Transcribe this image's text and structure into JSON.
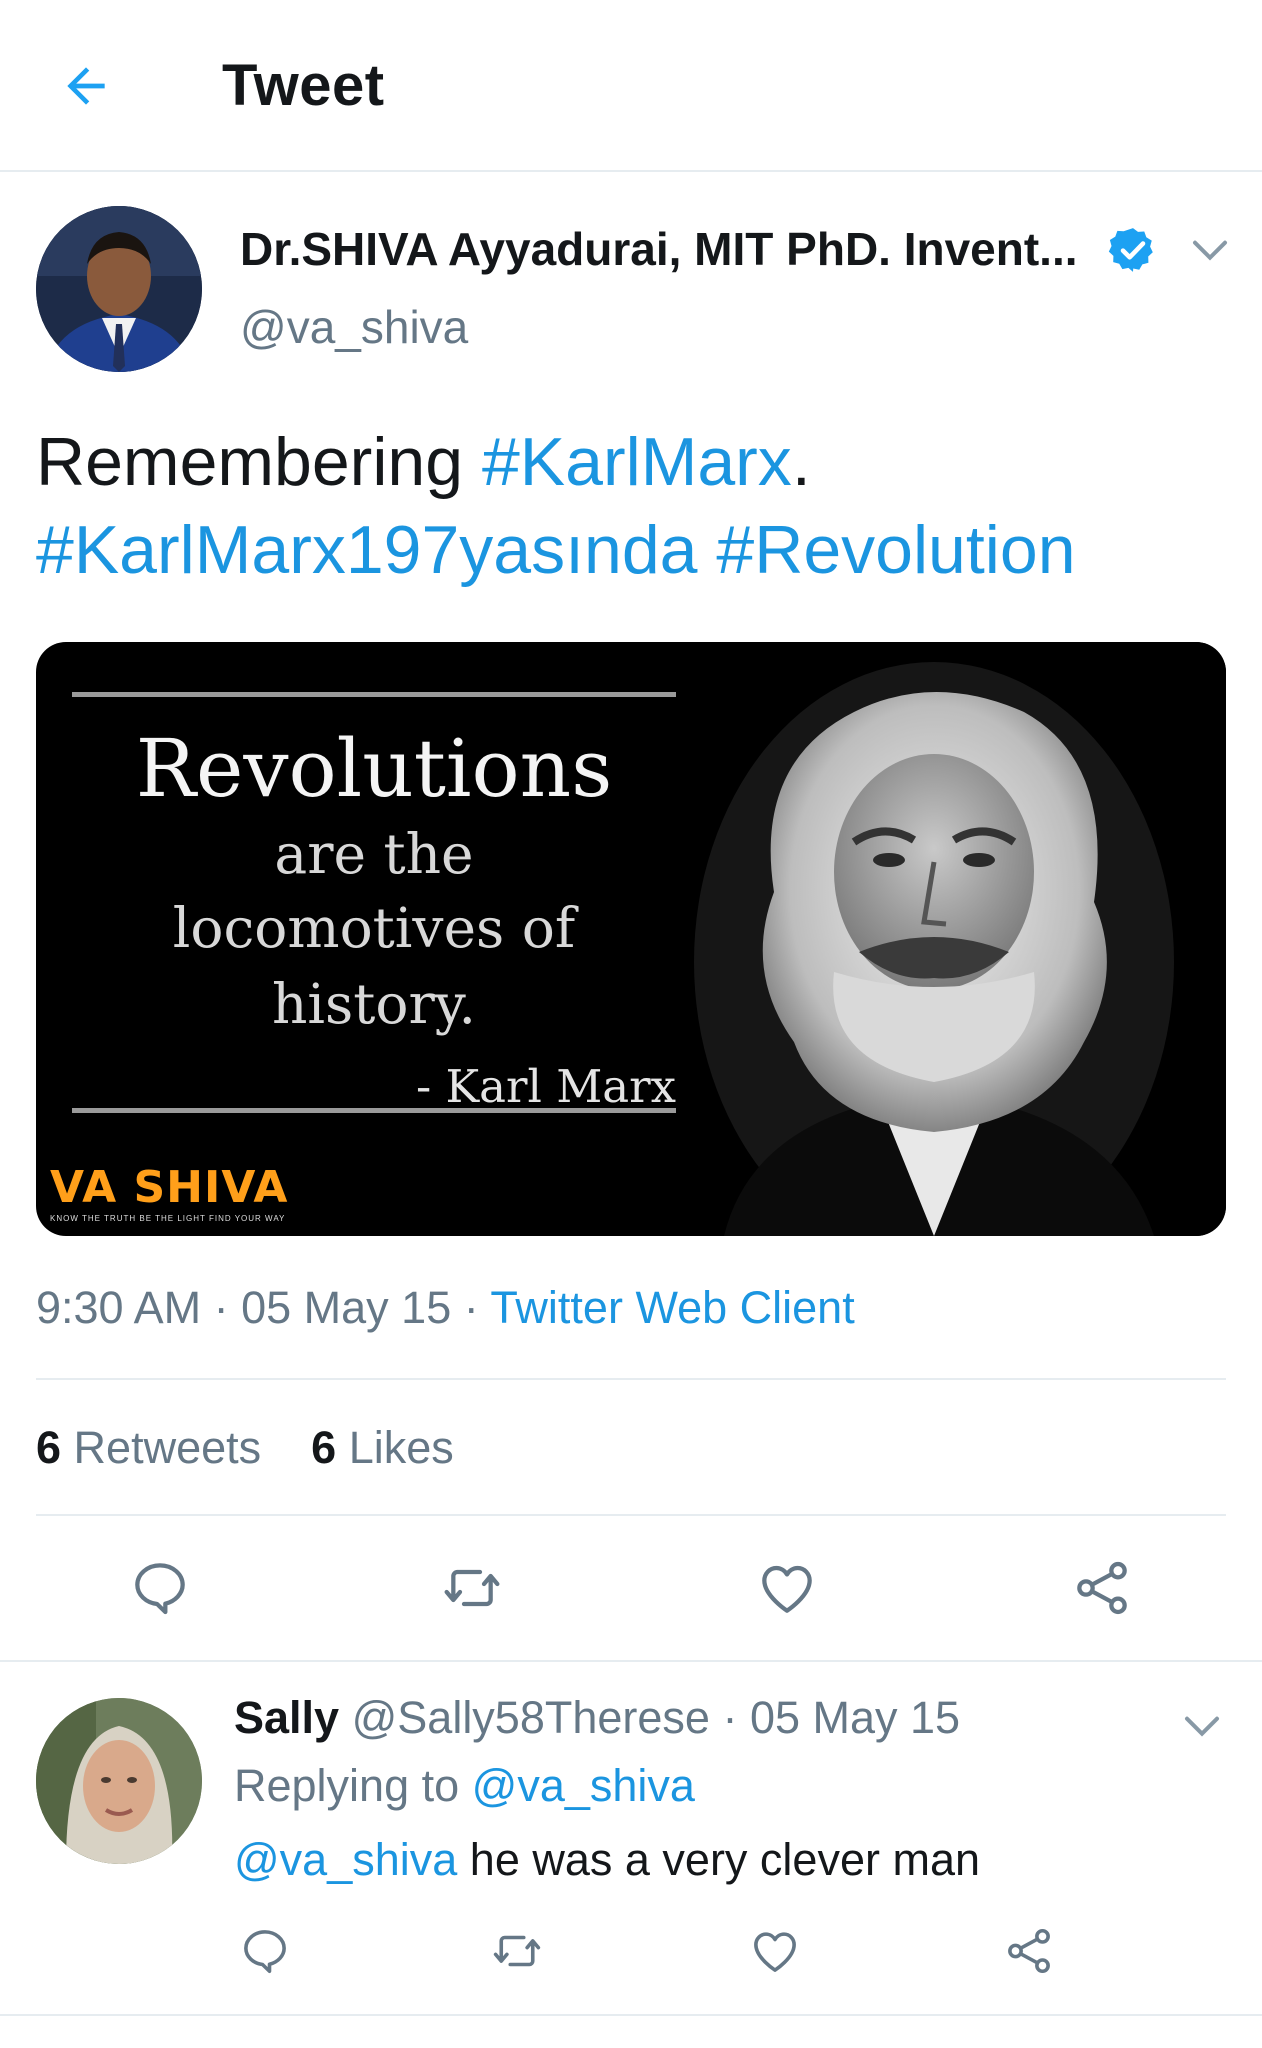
{
  "header": {
    "title": "Tweet",
    "back_icon": "arrow-left-icon"
  },
  "tweet": {
    "author": {
      "name": "Dr.SHIVA Ayyadurai, MIT PhD. Invent...",
      "handle": "@va_shiva",
      "verified": true
    },
    "text": {
      "prefix": "Remembering ",
      "hashtag1": "#KarlMarx",
      "period": ".",
      "hashtag2": "#KarlMarx197yasında",
      "hashtag3": "#Revolution"
    },
    "media": {
      "quote_line1": "Revolutions",
      "quote_line2": "are the",
      "quote_line3": "locomotives of",
      "quote_line4": "history.",
      "quote_author": "- Karl Marx",
      "brand": "VA SHIVA",
      "brand_tagline": "KNOW THE TRUTH   BE THE LIGHT   FIND YOUR WAY"
    },
    "time": "9:30 AM",
    "date": "05 May 15",
    "separator": " · ",
    "source": "Twitter Web Client",
    "stats": {
      "retweets_count": "6",
      "retweets_label": "Retweets",
      "likes_count": "6",
      "likes_label": "Likes"
    },
    "actions": [
      "reply-icon",
      "retweet-icon",
      "like-icon",
      "share-icon"
    ]
  },
  "reply": {
    "name": "Sally",
    "handle": "@Sally58Therese",
    "date": "05 May 15",
    "replying_to_label": "Replying to ",
    "replying_to_handle": "@va_shiva",
    "mention": "@va_shiva",
    "text": " he was a very clever man"
  },
  "colors": {
    "link_blue": "#1b95e0",
    "secondary_grey": "#657786",
    "text_dark": "#14171a",
    "brand_orange": "#ff9f1a"
  }
}
